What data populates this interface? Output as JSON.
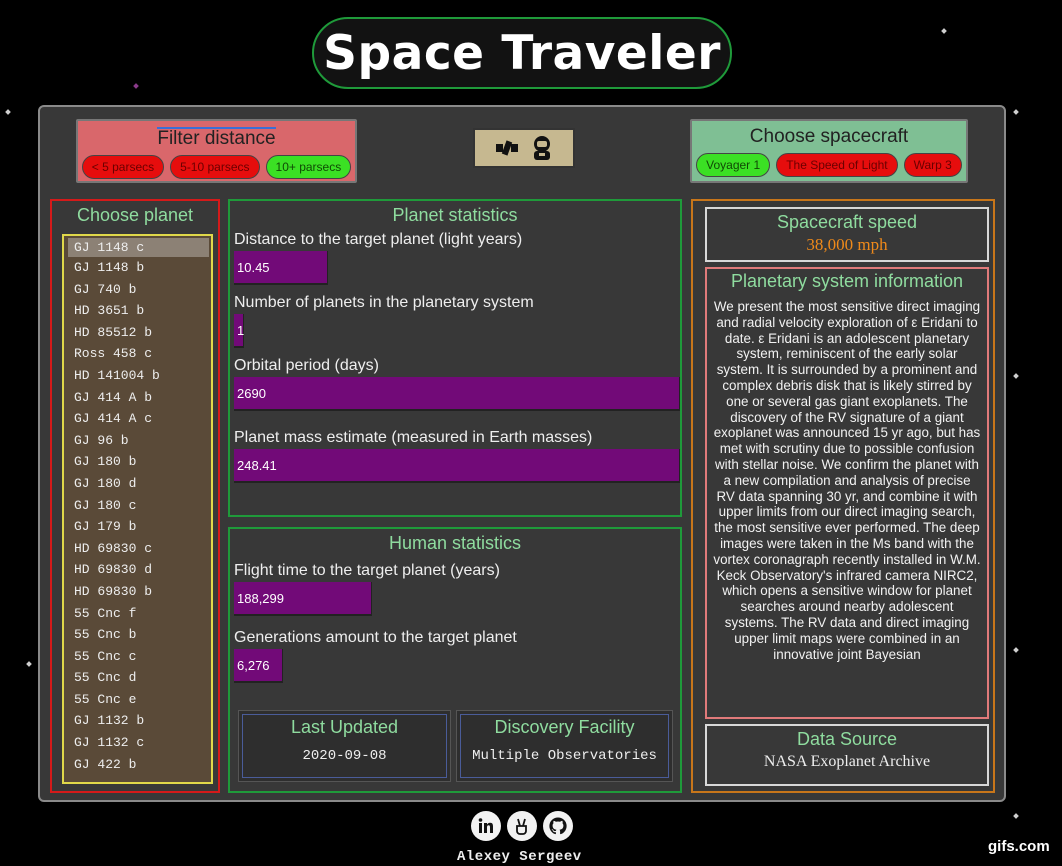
{
  "app": {
    "title": "Space Traveler"
  },
  "filter_distance": {
    "heading": "Filter distance",
    "options": [
      {
        "label": "< 5 parsecs",
        "active": false
      },
      {
        "label": "5-10 parsecs",
        "active": false
      },
      {
        "label": "10+ parsecs",
        "active": true
      }
    ]
  },
  "center_icons": [
    "satellite-icon",
    "astronaut-icon"
  ],
  "choose_spacecraft": {
    "heading": "Choose spacecraft",
    "options": [
      {
        "label": "Voyager 1",
        "active": true
      },
      {
        "label": "The Speed of Light",
        "active": false
      },
      {
        "label": "Warp 3",
        "active": false
      }
    ]
  },
  "choose_planet": {
    "heading": "Choose planet",
    "selected": "GJ 1148 c",
    "planets": [
      "GJ 1148 c",
      "GJ 1148 b",
      "GJ 740 b",
      "HD 3651 b",
      "HD 85512 b",
      "Ross 458 c",
      "HD 141004 b",
      "GJ 414 A b",
      "GJ 414 A c",
      "GJ 96 b",
      "GJ 180 b",
      "GJ 180 d",
      "GJ 180 c",
      "GJ 179 b",
      "HD 69830 c",
      "HD 69830 d",
      "HD 69830 b",
      "55 Cnc f",
      "55 Cnc b",
      "55 Cnc c",
      "55 Cnc d",
      "55 Cnc e",
      "GJ 1132 b",
      "GJ 1132 c",
      "GJ 422 b"
    ]
  },
  "planet_statistics": {
    "heading": "Planet statistics",
    "stats": [
      {
        "label": "Distance to the target planet (light years)",
        "value": "10.45",
        "fill": 0.21
      },
      {
        "label": "Number of planets in the planetary system",
        "value": "1",
        "fill": 0.02
      },
      {
        "label": "Orbital period (days)",
        "value": "2690",
        "fill": 1.0
      },
      {
        "label": "Planet mass estimate (measured in Earth masses)",
        "value": "248.41",
        "fill": 1.0
      }
    ]
  },
  "human_statistics": {
    "heading": "Human statistics",
    "stats": [
      {
        "label": "Flight time to the target planet (years)",
        "value": "188,299",
        "fill": 0.31
      },
      {
        "label": "Generations amount to the target planet",
        "value": "6,276",
        "fill": 0.11
      }
    ],
    "last_updated": {
      "heading": "Last Updated",
      "value": "2020-09-08"
    },
    "discovery_facility": {
      "heading": "Discovery Facility",
      "value": "Multiple Observatories"
    }
  },
  "spacecraft_speed": {
    "heading": "Spacecraft speed",
    "value": "38,000 mph"
  },
  "planetary_info": {
    "heading": "Planetary system information",
    "text": "We present the most sensitive direct imaging and radial velocity exploration of ε Eridani to date. ε Eridani is an adolescent planetary system, reminiscent of the early solar system. It is surrounded by a prominent and complex debris disk that is likely stirred by one or several gas giant exoplanets. The discovery of the RV signature of a giant exoplanet was announced 15 yr ago, but has met with scrutiny due to possible confusion with stellar noise. We confirm the planet with a new compilation and analysis of precise RV data spanning 30 yr, and combine it with upper limits from our direct imaging search, the most sensitive ever performed. The deep images were taken in the Ms band with the vortex coronagraph recently installed in W.M. Keck Observatory's infrared camera NIRC2, which opens a sensitive window for planet searches around nearby adolescent systems. The RV data and direct imaging upper limit maps were combined in an innovative joint Bayesian"
  },
  "data_source": {
    "heading": "Data Source",
    "value": "NASA Exoplanet Archive"
  },
  "footer": {
    "author": "Alexey Sergeev",
    "icons": [
      "linkedin-icon",
      "peace-hand-icon",
      "github-icon"
    ]
  },
  "watermark": "gifs.com",
  "colors": {
    "accent_green": "#1f9a3a",
    "bar_purple": "#720a78",
    "speed_orange": "#f08a1a",
    "planet_border": "#d41a1a"
  }
}
